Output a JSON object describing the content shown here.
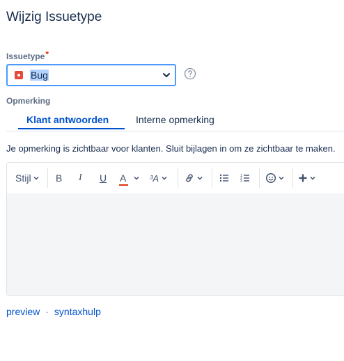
{
  "dialog": {
    "title": "Wijzig Issuetype"
  },
  "issuetype": {
    "label": "Issuetype",
    "required_mark": "*",
    "value": "Bug",
    "icon": "bug-icon",
    "help_icon": "question-circle-icon"
  },
  "comment": {
    "label": "Opmerking",
    "tabs": [
      "Klant antwoorden",
      "Interne opmerking"
    ],
    "active_tab": 0,
    "notice": "Je opmerking is zichtbaar voor klanten. Sluit bijlagen in om ze zichtbaar te maken."
  },
  "toolbar": {
    "style_label": "Stijl",
    "bold": "B",
    "italic": "I",
    "underline": "U",
    "color": "A",
    "more_format": "³A",
    "text_color_accent": "#de350b"
  },
  "footer": {
    "preview": "preview",
    "separator": "·",
    "syntax_help": "syntaxhulp"
  }
}
